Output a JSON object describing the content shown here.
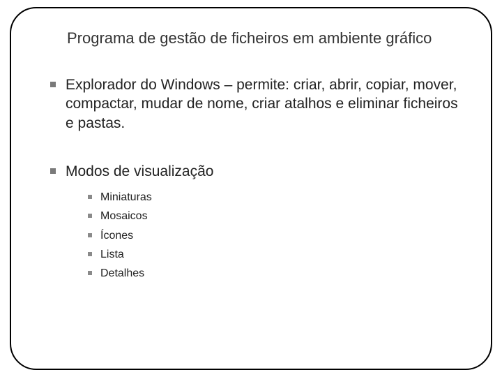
{
  "title": "Programa de gestão de ficheiros em ambiente gráfico",
  "bullets": [
    {
      "text": "Explorador do Windows – permite: criar, abrir, copiar, mover, compactar, mudar de nome, criar atalhos e eliminar ficheiros e pastas."
    },
    {
      "text": "Modos de visualização",
      "sub": [
        "Miniaturas",
        "Mosaicos",
        "Ícones",
        "Lista",
        "Detalhes"
      ]
    }
  ]
}
